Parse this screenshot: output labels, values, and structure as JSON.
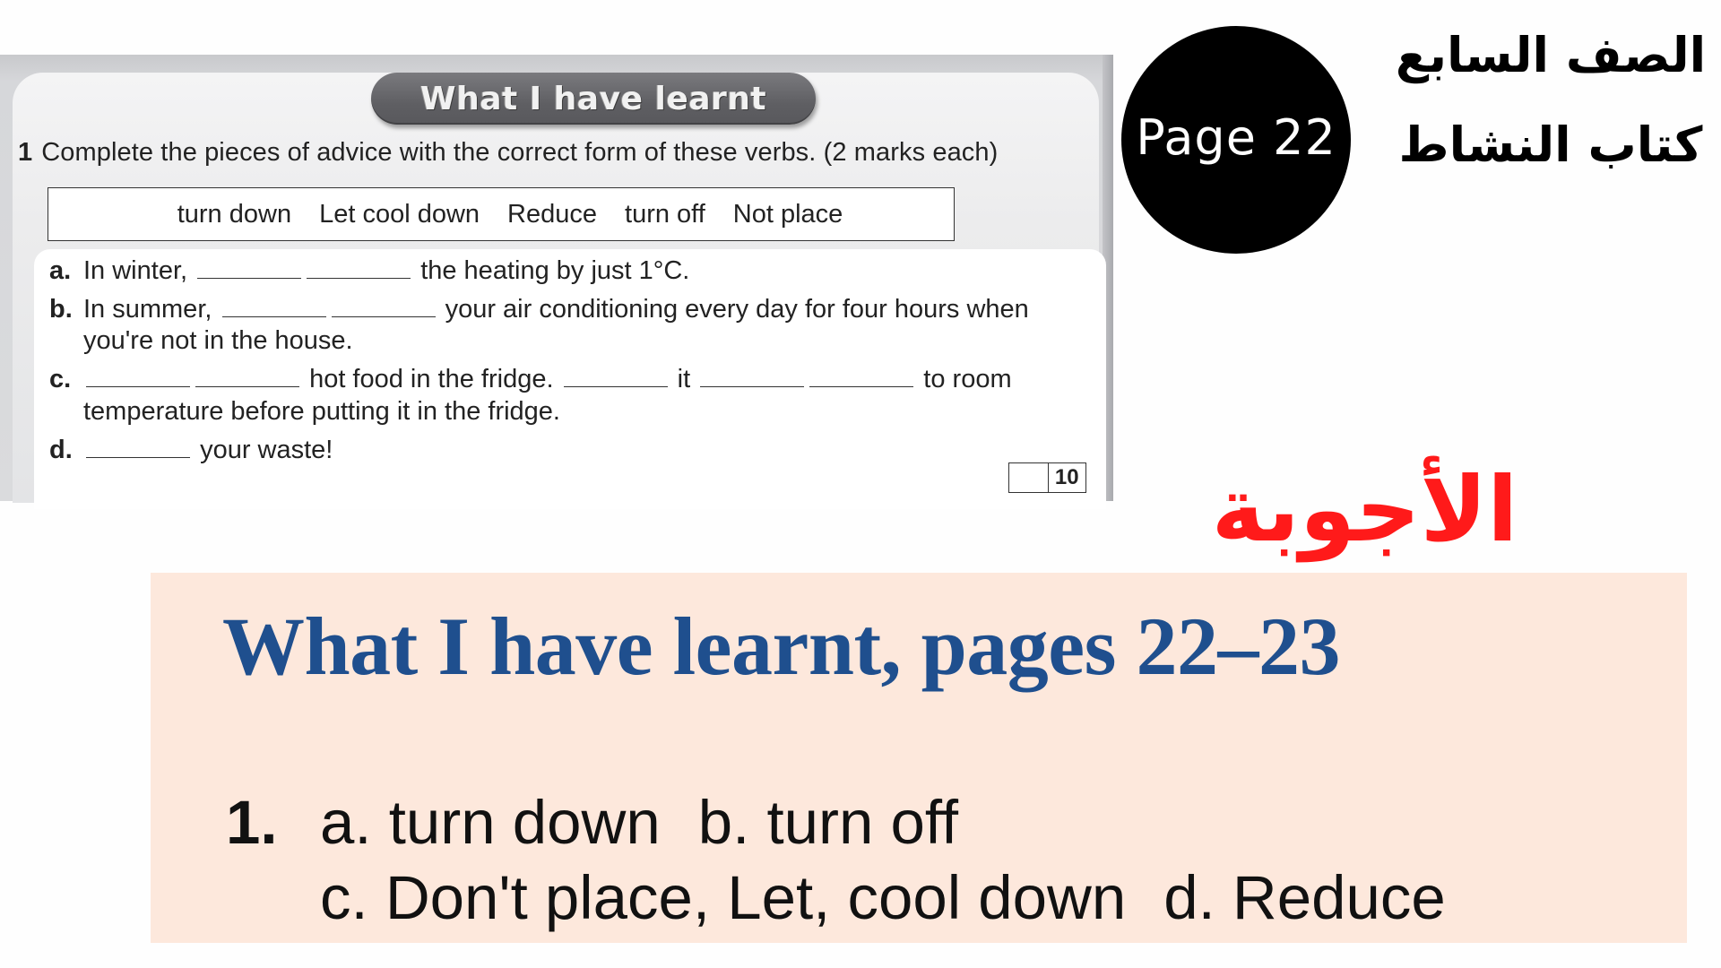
{
  "badge": {
    "page_label": "Page 22"
  },
  "arabic_header": {
    "line1": "الصف السابع",
    "line2": "كتاب النشاط"
  },
  "answers_heading": "الأجوبة",
  "worksheet": {
    "section_title": "What I have learnt",
    "exercise_number": "1",
    "instruction": "Complete the pieces of advice with the correct form of these verbs. (2 marks each)",
    "word_box": [
      "turn down",
      "Let cool down",
      "Reduce",
      "turn off",
      "Not place"
    ],
    "items": [
      {
        "label": "a.",
        "parts": [
          "In winter,",
          "the heating by just 1°C."
        ]
      },
      {
        "label": "b.",
        "parts": [
          "In summer,",
          "your air conditioning every day for four hours when",
          "you're not in the house."
        ]
      },
      {
        "label": "c.",
        "parts": [
          "hot food in the fridge.",
          "it",
          "to room",
          "temperature before putting it in the fridge."
        ]
      },
      {
        "label": "d.",
        "parts": [
          "your waste!"
        ]
      }
    ],
    "score_total": "10"
  },
  "answer_key": {
    "title": "What I have learnt, pages 22–23",
    "number": "1.",
    "line1": {
      "a": "a. turn down",
      "b": "b. turn off"
    },
    "line2": {
      "c": "c. Don't place, Let, cool down",
      "d": "d. Reduce"
    }
  },
  "colors": {
    "answer_heading": "#ff1a1a",
    "answer_title": "#1f4f8e",
    "answer_box_bg": "#fde8dc",
    "badge_bg": "#000000",
    "pill_bg": "#5f5f63"
  }
}
